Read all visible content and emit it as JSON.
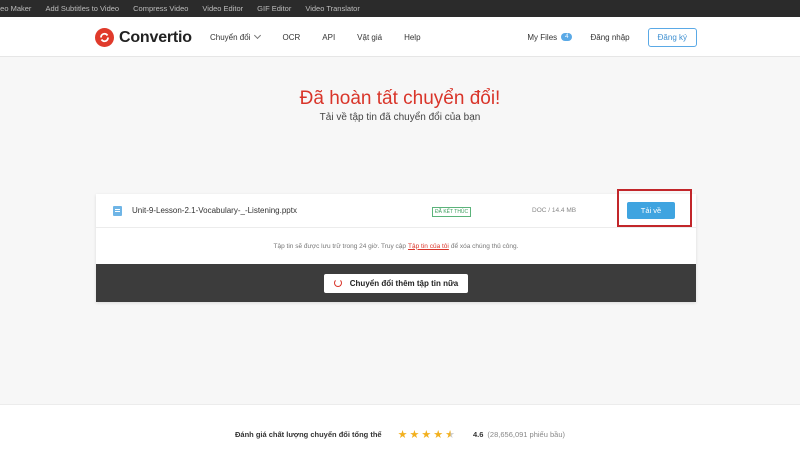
{
  "topbar": {
    "items": [
      "deo Maker",
      "Add Subtitles to Video",
      "Compress Video",
      "Video Editor",
      "GIF Editor",
      "Video Translator"
    ]
  },
  "navbar": {
    "logo_text": "Convertio",
    "links": [
      "Chuyển đổi",
      "OCR",
      "API",
      "Vật giá",
      "Help"
    ],
    "my_files_label": "My Files",
    "my_files_count": "4",
    "login_label": "Đăng nhập",
    "signup_label": "Đăng ký"
  },
  "hero": {
    "title": "Đã hoàn tất chuyển đổi!",
    "subtitle": "Tải về tập tin đã chuyển đổi của bạn"
  },
  "file": {
    "name": "Unit-9-Lesson-2.1-Vocabulary-_-Listening.pptx",
    "status": "ĐÃ KẾT THÚC",
    "meta": "DOC / 14.4 MB",
    "download_label": "Tải về"
  },
  "notice": {
    "before": "Tập tin sẽ được lưu trữ trong 24 giờ. Truy cập",
    "link": "Tập tin của tôi",
    "after": "để xóa chúng thủ công."
  },
  "convert_more_label": "Chuyển đổi thêm tập tin nữa",
  "rating": {
    "label": "Đánh giá chất lượng chuyển đổi tổng thể",
    "score": "4.6",
    "votes": "(28,656,091 phiếu bầu)",
    "stars_value": 4.6
  },
  "colors": {
    "brand_red": "#d9352a",
    "accent_blue": "#3fa4e0",
    "highlight_box": "#c2262a"
  }
}
